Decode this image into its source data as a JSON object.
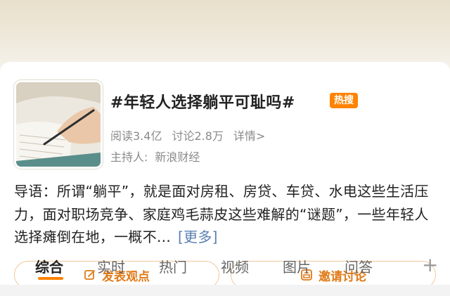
{
  "topic": {
    "title": "#年轻人选择躺平可耻吗#",
    "badge": "热搜",
    "stats": {
      "reads": "阅读3.4亿",
      "discussions": "讨论2.8万",
      "detail": "详情>"
    },
    "host_label": "主持人:",
    "host_name": "新浪财经"
  },
  "intro": {
    "text": "导语：所谓“躺平”，就是面对房租、房贷、车贷、水电这些生活压力，面对职场竞争、家庭鸡毛蒜皮这些难解的“谜题”，一些年轻人选择瘫倒在地，一概不...",
    "more": "[更多]"
  },
  "actions": {
    "post_label": "发表观点",
    "invite_label": "邀请讨论"
  },
  "tabs": [
    {
      "label": "综合",
      "active": true
    },
    {
      "label": "实时"
    },
    {
      "label": "热门"
    },
    {
      "label": "视频"
    },
    {
      "label": "图片"
    },
    {
      "label": "问答"
    }
  ],
  "colors": {
    "accent": "#ff8200",
    "link": "#5b7fb3",
    "muted": "#8a8a8a"
  }
}
